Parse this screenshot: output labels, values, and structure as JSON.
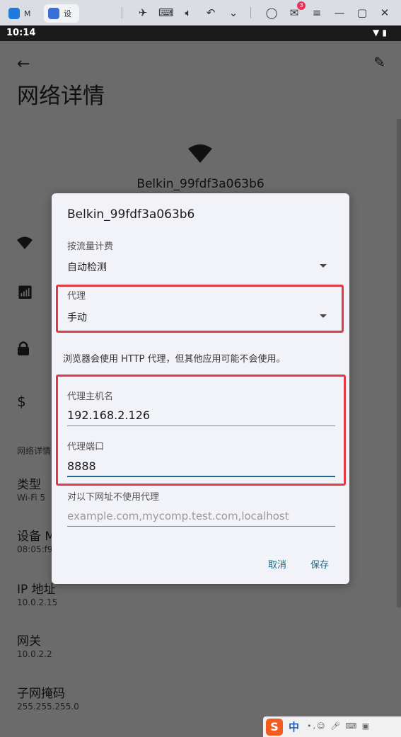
{
  "emulator": {
    "tab1_label": "M",
    "tab2_label": "设"
  },
  "notifications": {
    "count": "3"
  },
  "status_bar": {
    "time": "10:14"
  },
  "background": {
    "page_title": "网络详情",
    "network_name": "Belkin_99fdf3a063b6",
    "section_label": "网络详情",
    "items": [
      {
        "title": "类型",
        "value": "Wi-Fi 5"
      },
      {
        "title": "设备 M",
        "value": "08:05:f9"
      },
      {
        "title": "IP 地址",
        "value": "10.0.2.15"
      },
      {
        "title": "网关",
        "value": "10.0.2.2"
      },
      {
        "title": "子网掩码",
        "value": "255.255.255.0"
      }
    ]
  },
  "dialog": {
    "title": "Belkin_99fdf3a063b6",
    "metered_label": "按流量计费",
    "metered_value": "自动检测",
    "proxy_label": "代理",
    "proxy_value": "手动",
    "note": "浏览器会使用 HTTP 代理，但其他应用可能不会使用。",
    "host_label": "代理主机名",
    "host_value": "192.168.2.126",
    "port_label": "代理端口",
    "port_value": "8888",
    "bypass_label": "对以下网址不使用代理",
    "bypass_placeholder": "example.com,mycomp.test.com,localhost",
    "cancel_label": "取消",
    "save_label": "保存"
  },
  "ime": {
    "logo": "S",
    "mode": "中"
  },
  "colors": {
    "accent": "#1b6b8a",
    "highlight": "#e23a44",
    "dialog_bg": "#f2f3f8",
    "scrim": "#6b6b6b"
  }
}
